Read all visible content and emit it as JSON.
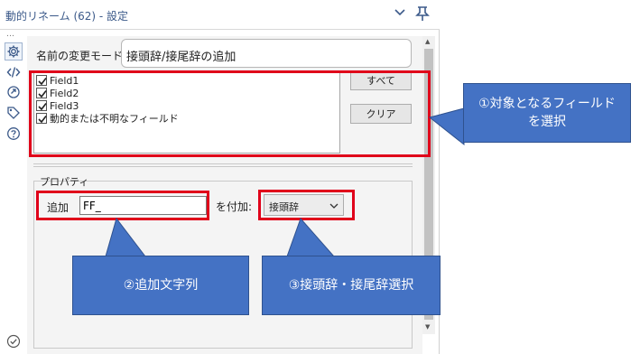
{
  "window": {
    "title": "動的リネーム (62) - 設定",
    "more_dots": "…"
  },
  "config": {
    "mode_label": "名前の変更モード:",
    "mode_value": "接頭辞/接尾辞の追加",
    "fields": [
      {
        "label": "Field1",
        "checked": true
      },
      {
        "label": "Field2",
        "checked": true
      },
      {
        "label": "Field3",
        "checked": true
      },
      {
        "label": "動的または不明なフィールド",
        "checked": true
      }
    ],
    "select_all_label": "すべて",
    "clear_label": "クリア"
  },
  "properties": {
    "section_label": "プロパティ",
    "add_label": "追加",
    "add_value": "FF_",
    "attach_label": "を付加:",
    "position_value": "接頭辞"
  },
  "callouts": {
    "c1_line1": "①対象となるフィールド",
    "c1_line2": "を選択",
    "c2": "②追加文字列",
    "c3": "③接頭辞・接尾辞選択"
  },
  "colors": {
    "highlight": "#e0001a",
    "callout_fill": "#4472c4",
    "title_text": "#3c5a8a"
  },
  "icons": [
    "gear-icon",
    "code-icon",
    "rotate-icon",
    "tag-icon",
    "help-icon",
    "check-circle-icon",
    "chevron-down-icon",
    "pin-icon"
  ]
}
